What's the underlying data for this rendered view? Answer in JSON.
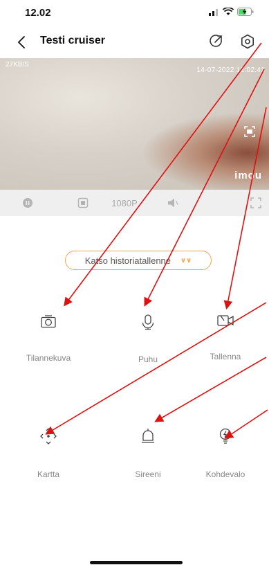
{
  "status_bar": {
    "time": "12.02"
  },
  "header": {
    "title": "Testi cruiser"
  },
  "video": {
    "bitrate": "27KB/S",
    "timestamp": "14-07-2022 12:02:41",
    "brand": "imou"
  },
  "controls": {
    "resolution": "1080P"
  },
  "history_button": {
    "label": "Katso historiatallenne"
  },
  "features": [
    {
      "label": "Tilannekuva",
      "icon": "camera-icon"
    },
    {
      "label": "Puhu",
      "icon": "microphone-icon"
    },
    {
      "label": "Tallenna",
      "icon": "video-record-icon"
    },
    {
      "label": "Kartta",
      "icon": "pan-tilt-icon"
    },
    {
      "label": "Sireeni",
      "icon": "siren-icon"
    },
    {
      "label": "Kohdevalo",
      "icon": "spotlight-icon"
    }
  ],
  "colors": {
    "accent": "#f3a847",
    "annotation_arrow": "#e01010"
  }
}
